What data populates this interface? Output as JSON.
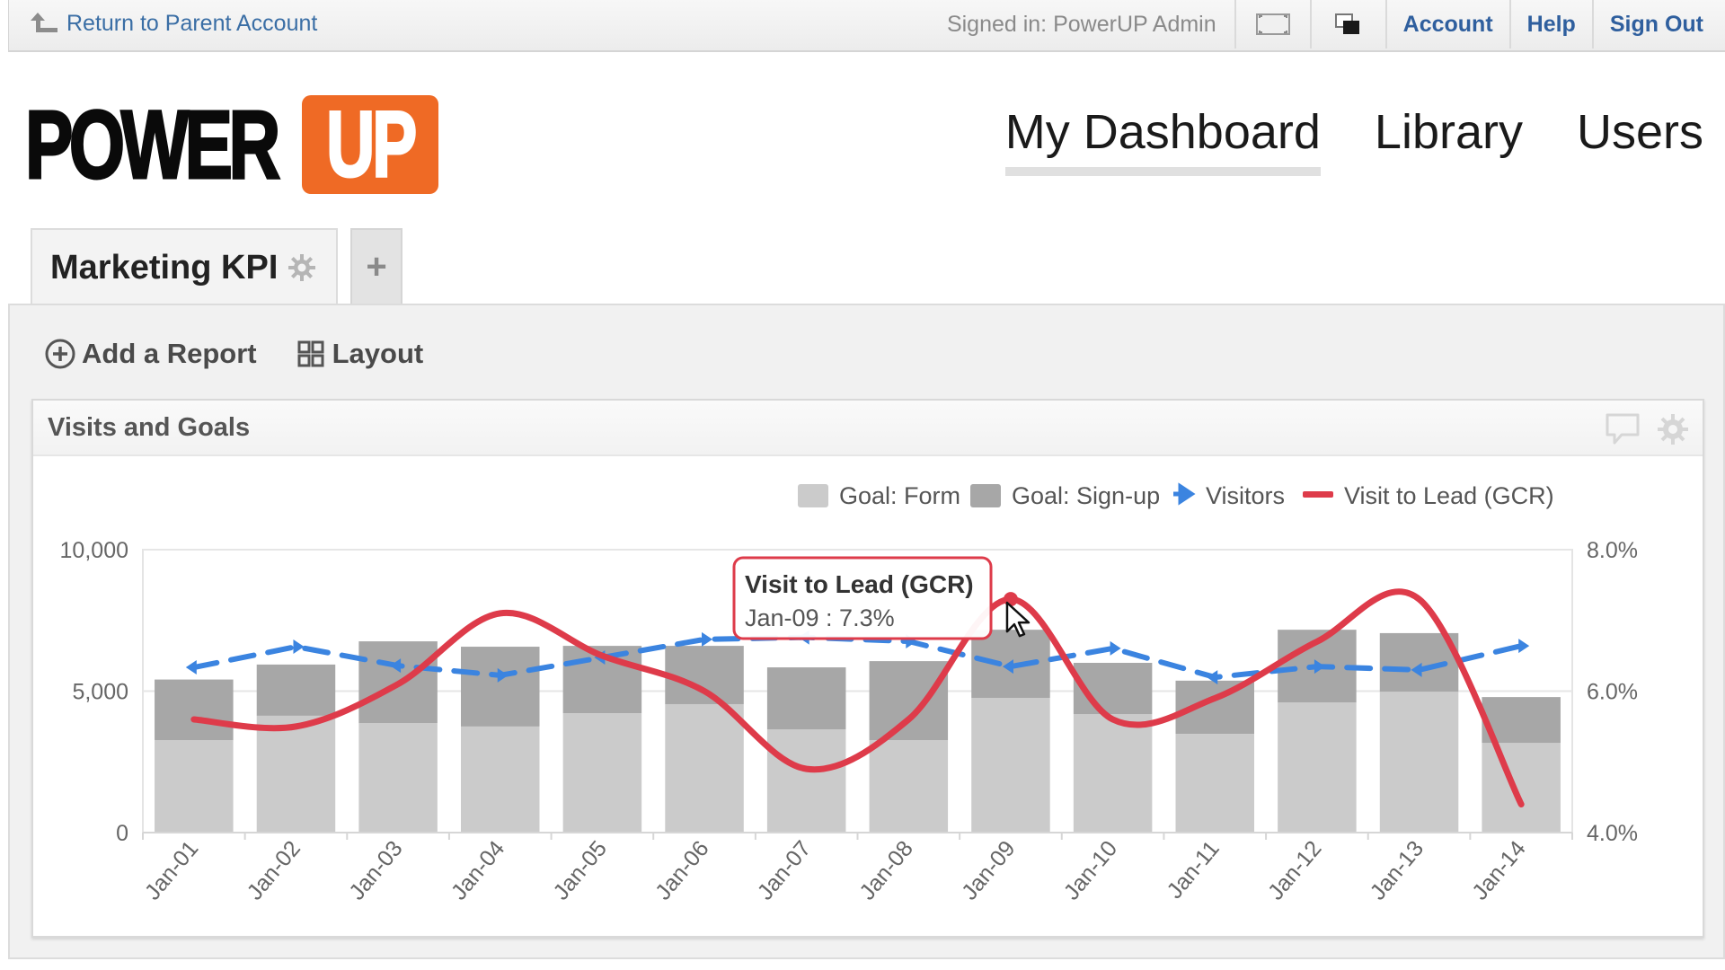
{
  "topbar": {
    "return_label": "Return to Parent Account",
    "signed_in": "Signed in: PowerUP Admin",
    "links": [
      "Account",
      "Help",
      "Sign Out"
    ],
    "icons": [
      "fullscreen-icon",
      "window-icon"
    ]
  },
  "logo": {
    "left": "POWER",
    "right": "UP",
    "accent": "#ef6a25"
  },
  "mainnav": [
    {
      "label": "My Dashboard",
      "active": true
    },
    {
      "label": "Library",
      "active": false
    },
    {
      "label": "Users",
      "active": false
    }
  ],
  "tabs": [
    {
      "label": "Marketing KPI",
      "active": true
    }
  ],
  "tab_add_label": "+",
  "toolbar": {
    "add_report": "Add a Report",
    "layout": "Layout"
  },
  "report": {
    "title": "Visits and Goals"
  },
  "tooltip": {
    "title": "Visit to Lead (GCR)",
    "body": "Jan-09 : 7.3%"
  },
  "colors": {
    "form": "#cbcbcb",
    "signup": "#a7a7a7",
    "visitors": "#3b84e0",
    "gcr": "#de3b4a",
    "link": "#2f5f9e"
  },
  "chart_data": {
    "type": "bar",
    "title": "Visits and Goals",
    "categories": [
      "Jan-01",
      "Jan-02",
      "Jan-03",
      "Jan-04",
      "Jan-05",
      "Jan-06",
      "Jan-07",
      "Jan-08",
      "Jan-09",
      "Jan-10",
      "Jan-11",
      "Jan-12",
      "Jan-13",
      "Jan-14"
    ],
    "series": [
      {
        "name": "Goal: Form",
        "type": "stacked-bar",
        "axis": "left",
        "values": [
          3270,
          4130,
          3870,
          3750,
          4220,
          4540,
          3650,
          3270,
          4760,
          4190,
          3490,
          4600,
          4980,
          3170
        ]
      },
      {
        "name": "Goal: Sign-up",
        "type": "stacked-bar",
        "axis": "left",
        "values": [
          2140,
          1810,
          2890,
          2820,
          2380,
          2060,
          2190,
          2790,
          2410,
          1810,
          1880,
          2570,
          2070,
          1620
        ]
      },
      {
        "name": "Visitors",
        "type": "dashed-line",
        "axis": "left",
        "values": [
          5840,
          6570,
          5900,
          5560,
          6190,
          6830,
          6900,
          6760,
          5870,
          6510,
          5490,
          5870,
          5750,
          6600
        ]
      },
      {
        "name": "Visit to Lead (GCR)",
        "type": "smooth-line",
        "axis": "right",
        "values": [
          5.6,
          5.5,
          6.1,
          7.1,
          6.5,
          6.0,
          4.9,
          5.6,
          7.3,
          5.6,
          5.9,
          6.7,
          7.3,
          4.4
        ]
      }
    ],
    "left_axis": {
      "ticks": [
        "0",
        "5,000",
        "10,000"
      ],
      "tick_values": [
        0,
        5000,
        10000
      ],
      "ylim": [
        0,
        10000
      ]
    },
    "right_axis": {
      "ticks": [
        "4.0%",
        "6.0%",
        "8.0%"
      ],
      "tick_values": [
        4,
        6,
        8
      ],
      "ylim": [
        4,
        8
      ]
    },
    "legend": [
      "Goal: Form",
      "Goal: Sign-up",
      "Visitors",
      "Visit to Lead (GCR)"
    ],
    "legend_position": "top-right",
    "grid": true,
    "highlighted": {
      "series": "Visit to Lead (GCR)",
      "category": "Jan-09",
      "value": 7.3
    }
  }
}
